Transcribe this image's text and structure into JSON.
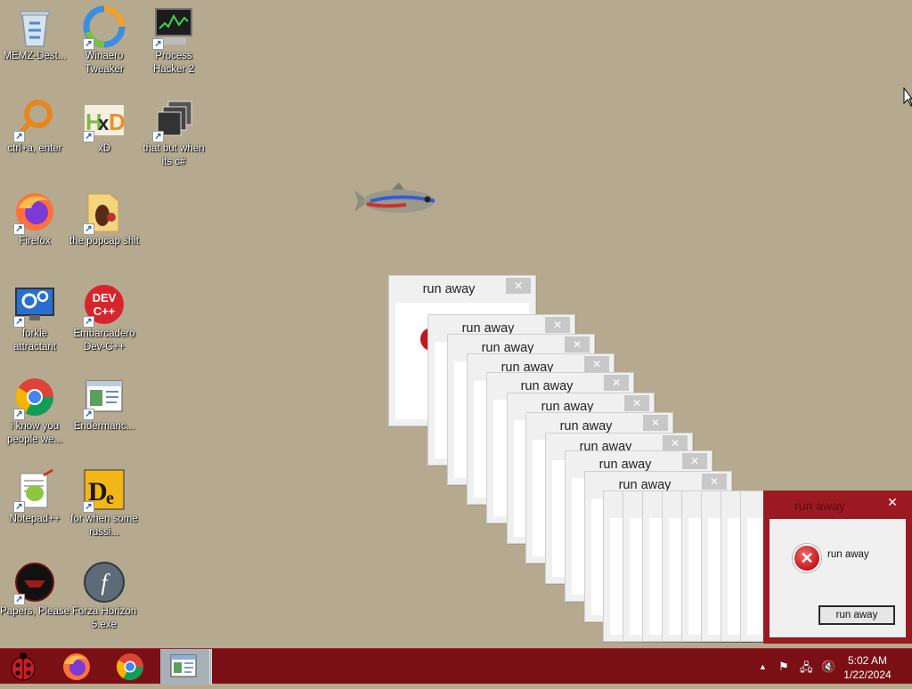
{
  "desktop": {
    "icons": [
      {
        "label": "MEMZ-Dest..."
      },
      {
        "label": "Winaero Tweaker"
      },
      {
        "label": "Process Hacker 2"
      },
      {
        "label": "ctrl+a, enter"
      },
      {
        "label": "xD"
      },
      {
        "label": "that but when its c#"
      },
      {
        "label": "Firefox"
      },
      {
        "label": "the popcap shit"
      },
      {
        "label": "forkie attractant"
      },
      {
        "label": "Embarcadero Dev-C++"
      },
      {
        "label": "i know you people we..."
      },
      {
        "label": "Endermanc..."
      },
      {
        "label": "Notepad++"
      },
      {
        "label": "for when some russi..."
      },
      {
        "label": "Papers, Please"
      },
      {
        "label": "Forza Horizon 5.exe"
      }
    ]
  },
  "dialogs": {
    "title": "run away",
    "close_glyph": "✕",
    "message": "run away",
    "button_label": "run away",
    "error_glyph": "✕"
  },
  "taskbar": {
    "start_icon": "ladybug-start-icon",
    "pinned": [
      "firefox-icon",
      "chrome-icon",
      "window-app-icon"
    ],
    "tray": {
      "chevron": "▲",
      "flag": "⚑",
      "network": "🖧",
      "volume": "🔇"
    },
    "clock": {
      "time": "5:02 AM",
      "date": "1/22/2024"
    }
  },
  "colors": {
    "desktop_bg": "#b5aa90",
    "taskbar_bg": "#7a1015",
    "active_dialog": "#9b1a22"
  }
}
